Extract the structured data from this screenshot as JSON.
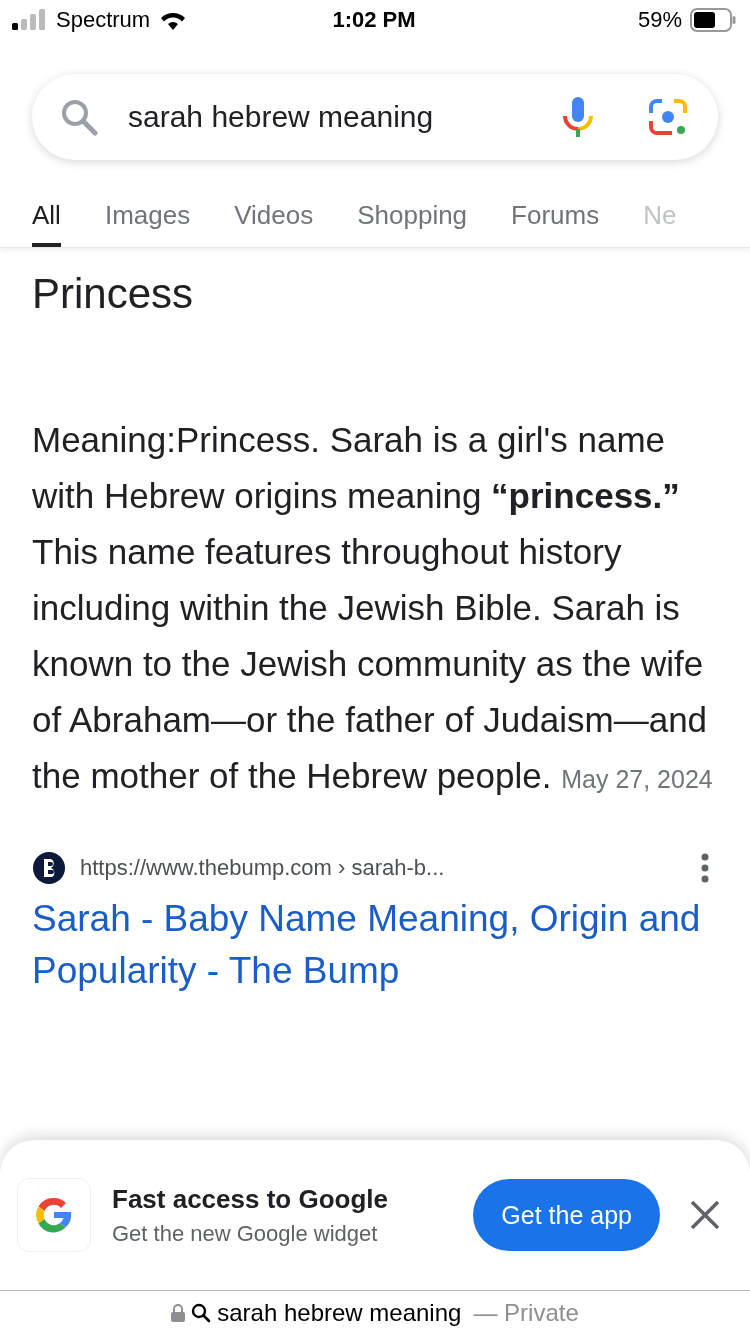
{
  "status_bar": {
    "carrier": "Spectrum",
    "time": "1:02 PM",
    "battery": "59%"
  },
  "search": {
    "value": "sarah hebrew meaning"
  },
  "tabs": [
    {
      "label": "All",
      "selected": true
    },
    {
      "label": "Images",
      "selected": false
    },
    {
      "label": "Videos",
      "selected": false
    },
    {
      "label": "Shopping",
      "selected": false
    },
    {
      "label": "Forums",
      "selected": false
    },
    {
      "label": "Ne",
      "selected": false
    }
  ],
  "snippet": {
    "heading": "Princess",
    "text": "Meaning:Princess. Sarah is a girl's name with Hebrew origins meaning **“princess.”** This name features throughout history including within the Jewish Bible. Sarah is known to the Jewish community as the wife of Abraham—or the father of Judaism—and the mother of the Hebrew people.",
    "date": "May 27, 2024"
  },
  "result": {
    "url": "https://www.thebump.com › sarah-b...",
    "title": "Sarah - Baby Name Meaning, Origin and Popularity - The Bump"
  },
  "app_banner": {
    "title": "Fast access to Google",
    "subtitle": "Get the new Google widget",
    "button": "Get the app"
  },
  "address_bar": {
    "query": "sarah hebrew meaning",
    "mode": "— Private"
  }
}
